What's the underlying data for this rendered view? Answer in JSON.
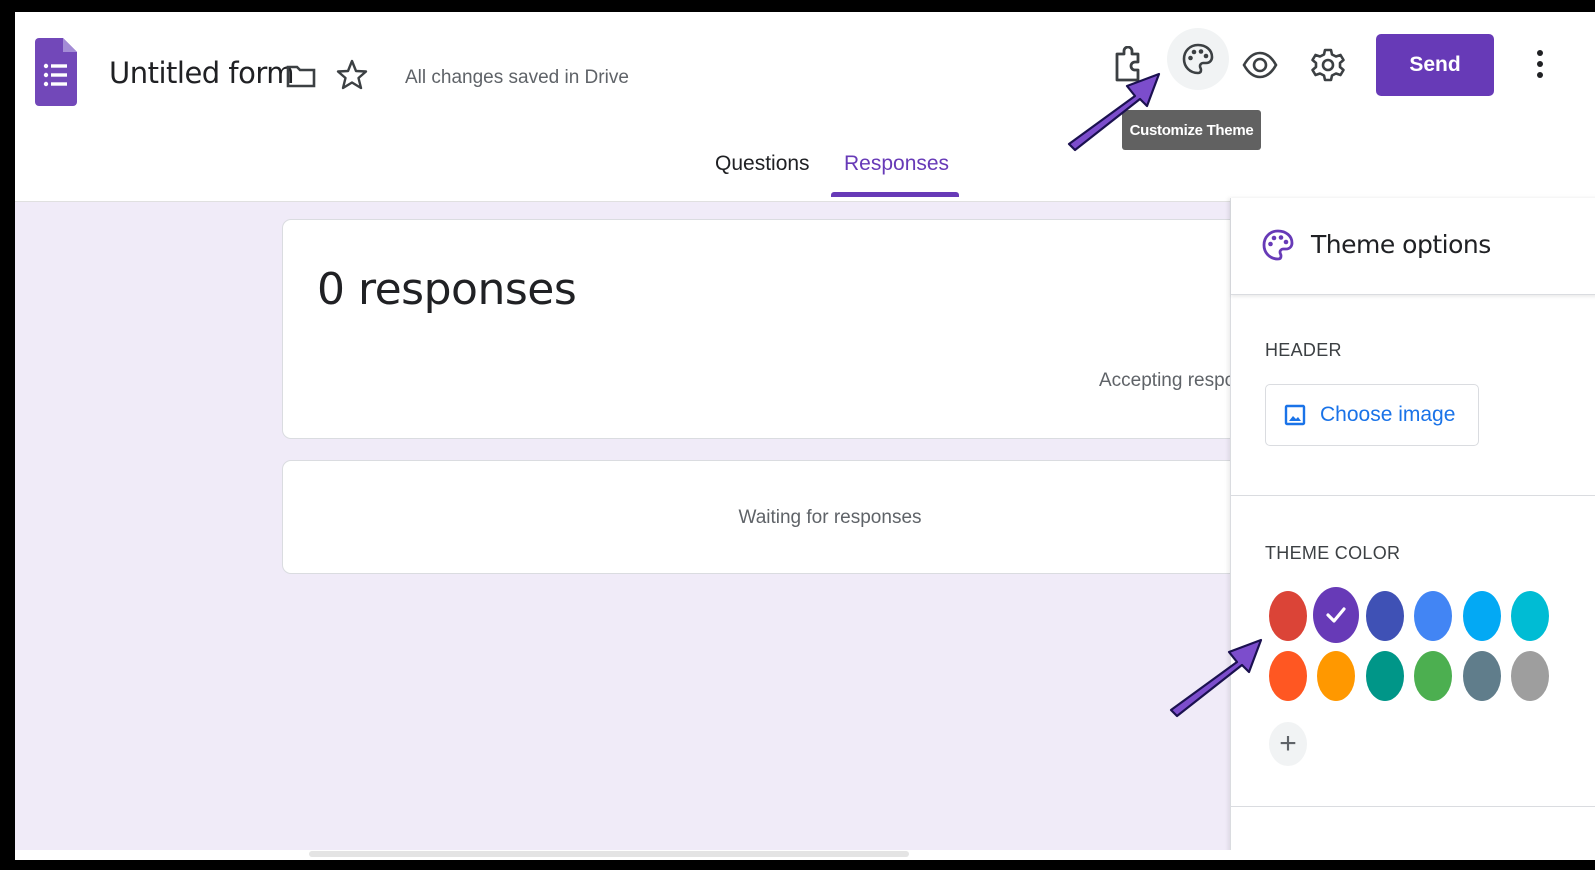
{
  "header": {
    "form_title": "Untitled form",
    "save_status": "All changes saved in Drive",
    "send_label": "Send",
    "tooltip": "Customize Theme",
    "brand_color": "#673ab7"
  },
  "tabs": [
    {
      "label": "Questions",
      "active": false
    },
    {
      "label": "Responses",
      "active": true
    }
  ],
  "summary": {
    "count_label": "0 responses",
    "accepting_label": "Accepting responses"
  },
  "waiting": {
    "label": "Waiting for responses"
  },
  "theme_panel": {
    "title": "Theme options",
    "header_section": "HEADER",
    "choose_image": "Choose image",
    "theme_color_section": "THEME COLOR",
    "swatches": [
      {
        "name": "red",
        "color": "#db4437",
        "selected": false
      },
      {
        "name": "deep-purple",
        "color": "#673ab7",
        "selected": true
      },
      {
        "name": "indigo",
        "color": "#3f51b5",
        "selected": false
      },
      {
        "name": "blue",
        "color": "#4285f4",
        "selected": false
      },
      {
        "name": "light-blue",
        "color": "#03a9f4",
        "selected": false
      },
      {
        "name": "cyan",
        "color": "#00bcd4",
        "selected": false
      },
      {
        "name": "deep-orange",
        "color": "#ff5722",
        "selected": false
      },
      {
        "name": "orange",
        "color": "#ff9800",
        "selected": false
      },
      {
        "name": "teal",
        "color": "#009688",
        "selected": false
      },
      {
        "name": "green",
        "color": "#4caf50",
        "selected": false
      },
      {
        "name": "blue-grey",
        "color": "#607d8b",
        "selected": false
      },
      {
        "name": "grey",
        "color": "#9e9e9e",
        "selected": false
      }
    ],
    "add_label": "+"
  },
  "icons": [
    "forms-logo-icon",
    "folder-icon",
    "star-icon",
    "addon-icon",
    "palette-icon",
    "eye-icon",
    "gear-icon",
    "more-vert-icon",
    "image-icon",
    "check-icon"
  ]
}
